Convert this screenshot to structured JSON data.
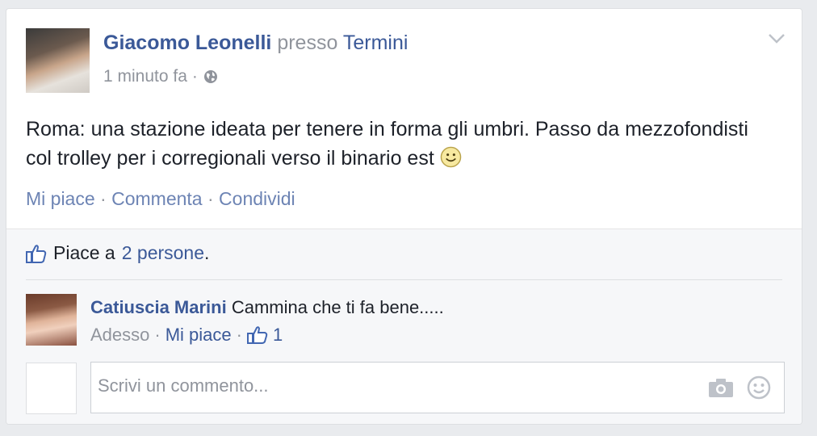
{
  "post": {
    "author": "Giacomo Leonelli",
    "presso": "presso",
    "place": "Termini",
    "time": "1 minuto fa",
    "dot": "·",
    "text": "Roma: una stazione ideata per tenere in forma gli umbri. Passo da mezzofondisti col trolley per i corregionali verso il binario est",
    "actions": {
      "like": "Mi piace",
      "comment": "Commenta",
      "share": "Condividi",
      "sep": "·"
    }
  },
  "likes": {
    "prefix": "Piace a",
    "count_label": "2 persone",
    "suffix": "."
  },
  "comment": {
    "author": "Catiuscia Marini",
    "text": "Cammina che ti fa bene.....",
    "time": "Adesso",
    "like": "Mi piace",
    "sep": "·",
    "like_count": "1"
  },
  "composer": {
    "placeholder": "Scrivi un commento..."
  },
  "icons": {
    "globe": "globe-icon",
    "chevron": "chevron-down-icon",
    "smile": "smiley-emoji-icon",
    "thumb": "thumbs-up-icon",
    "camera": "camera-icon",
    "emoji": "emoji-icon"
  },
  "colors": {
    "link": "#3b5998",
    "secondary": "#90949c",
    "text": "#1d2129",
    "action": "#6d84b4"
  }
}
